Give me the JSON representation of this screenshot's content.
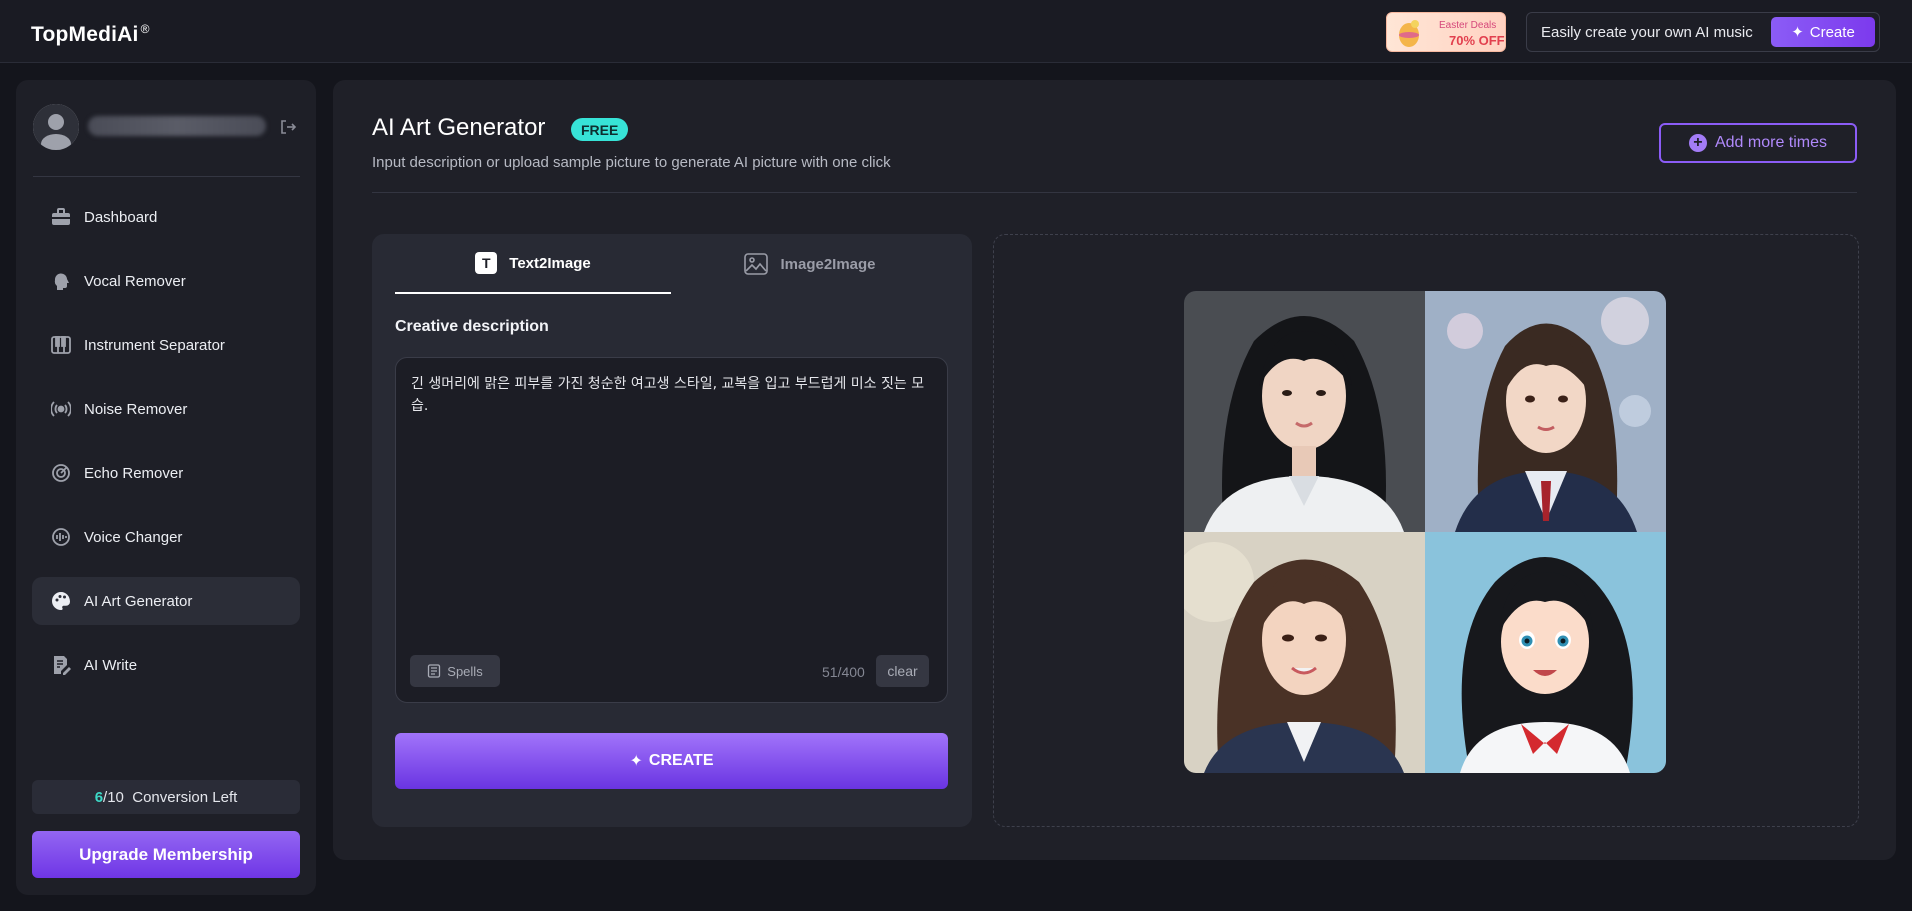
{
  "topbar": {
    "logo_text": "TopMedi",
    "logo_ai": "Ai",
    "logo_reg": "®",
    "promo": {
      "line1": "Easter Deals",
      "line2": "70% OFF"
    },
    "music_text": "Easily create your own AI music",
    "create_label": "Create"
  },
  "sidebar": {
    "items": [
      {
        "label": "Dashboard",
        "icon": "briefcase-icon"
      },
      {
        "label": "Vocal Remover",
        "icon": "head-icon"
      },
      {
        "label": "Instrument Separator",
        "icon": "piano-icon"
      },
      {
        "label": "Noise Remover",
        "icon": "broadcast-icon"
      },
      {
        "label": "Echo Remover",
        "icon": "echo-icon"
      },
      {
        "label": "Voice Changer",
        "icon": "voice-changer-icon"
      },
      {
        "label": "AI Art Generator",
        "icon": "palette-icon",
        "active": true
      },
      {
        "label": "AI Write",
        "icon": "edit-doc-icon"
      }
    ],
    "conversion": {
      "used": "6",
      "total": "/10",
      "label": "Conversion Left"
    },
    "upgrade_label": "Upgrade Membership"
  },
  "main": {
    "title": "AI Art Generator",
    "badge": "FREE",
    "subtitle": "Input description or upload sample picture to generate AI picture with one click",
    "add_times_label": "Add more times",
    "tabs": [
      {
        "label": "Text2Image",
        "active": true
      },
      {
        "label": "Image2Image",
        "active": false
      }
    ],
    "creative_label": "Creative description",
    "description": "긴 생머리에 맑은 피부를 가진 청순한 여고생 스타일, 교복을 입고 부드럽게 미소 짓는 모습.",
    "spells_label": "Spells",
    "count": "51/400",
    "clear_label": "clear",
    "create_label": "CREATE"
  },
  "colors": {
    "accent": "#8b5cf6",
    "badge": "#37e3d7",
    "background": "#14151c"
  }
}
